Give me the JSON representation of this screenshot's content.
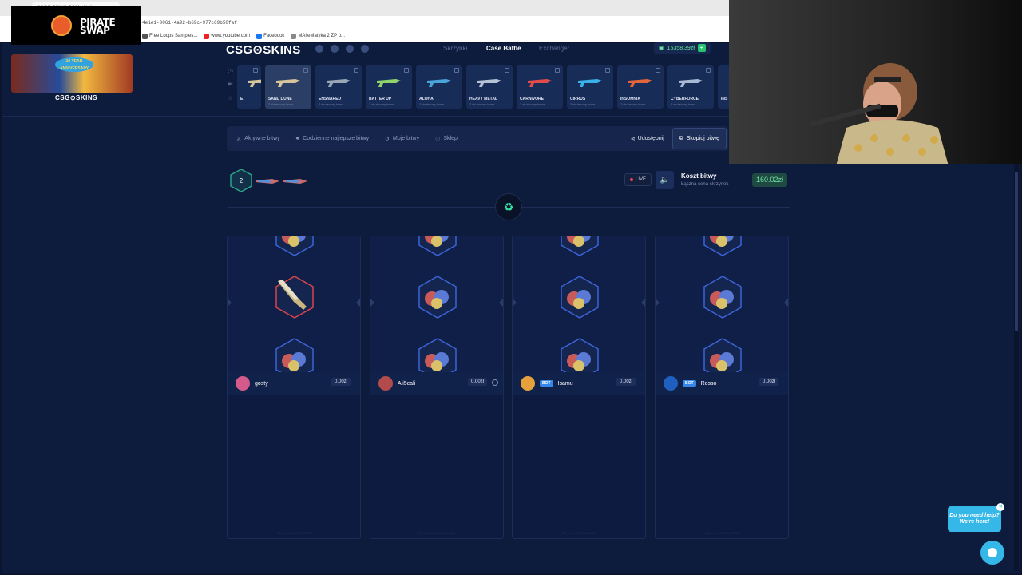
{
  "browser": {
    "tab_title": "CSGO-SKINS.COM - Najlep...",
    "url": "4e1e1-0061-4a92-b69c-977c69b50faf",
    "bookmarks": [
      "Free Loops Samples...",
      "www.youtube.com",
      "Facebook",
      "MAlleMatyka 2 ZP p..."
    ]
  },
  "overlay": {
    "brand_line1": "PIRATE",
    "brand_line2": "SWAP"
  },
  "site": {
    "banner_text": "10 YEAR ANNIVERSARY",
    "left_brand": "CSG⊙SKINS",
    "brand": "CSG⊙SKINS",
    "nav": [
      "Skrzynki",
      "Case Battle",
      "Exchanger"
    ],
    "nav_active": "Case Battle",
    "balance": "15358.39zł",
    "balance_plus": "+"
  },
  "cases": [
    {
      "name": "E",
      "sub": "...",
      "color": "#d6c49a"
    },
    {
      "name": "SAND DUNE",
      "sub": "3 skuteczny tema",
      "color": "#d6c49a"
    },
    {
      "name": "ENSNARED",
      "sub": "2 skuteczny tema",
      "color": "#9aa6b8"
    },
    {
      "name": "BATTER UP",
      "sub": "2 skuteczny tema",
      "color": "#8fd36b"
    },
    {
      "name": "ALOHA",
      "sub": "2 skuteczny tema",
      "color": "#4aa3d9"
    },
    {
      "name": "HEAVY METAL",
      "sub": "2 skuteczny tema",
      "color": "#b6c2d6"
    },
    {
      "name": "CARNIVORE",
      "sub": "2 skuteczny tema",
      "color": "#e14b4b"
    },
    {
      "name": "CIRRUS",
      "sub": "2 skuteczny tema",
      "color": "#3ab0e8"
    },
    {
      "name": "INSOMNIA",
      "sub": "2 skuteczny tema",
      "color": "#e2663a"
    },
    {
      "name": "CYBERFORCE",
      "sub": "2 skuteczny tema",
      "color": "#a9b8d4"
    },
    {
      "name": "INS",
      "sub": "...",
      "color": "#c6d0e0"
    }
  ],
  "battle_nav": {
    "items": [
      "Aktywne bitwy",
      "Codzienne najlepsze bitwy",
      "Moje bitwy",
      "Sklep"
    ],
    "share": "Udostępnij",
    "copy": "Skopiuj bitwę"
  },
  "battle": {
    "round": "2",
    "live": "LIVE",
    "cost_title": "Koszt bitwy",
    "cost_sub": "Łączna cena skrzynek",
    "cost_value": "160.02zł"
  },
  "players": [
    {
      "name": "gosty",
      "value": "0.00zł",
      "bot": false,
      "avatar_color": "#d35a8a",
      "winner_knife": true,
      "emote": false
    },
    {
      "name": "Ali5cali",
      "value": "0.00zł",
      "bot": false,
      "avatar_color": "#b24c4c",
      "winner_knife": false,
      "emote": true
    },
    {
      "name": "Isamu",
      "value": "0.00zł",
      "bot": true,
      "avatar_color": "#e6a13c",
      "winner_knife": false,
      "emote": false
    },
    {
      "name": "Rosso",
      "value": "0.00zł",
      "bot": true,
      "avatar_color": "#1f5fbf",
      "winner_knife": false,
      "emote": false
    }
  ],
  "bot_label": "BOT",
  "seeds": [
    "Client seed: 174c08005",
    "Client seed: ascmvbhh62aa",
    "Client seed: 174c08005",
    "Client seed: 174c08005"
  ],
  "help": {
    "text_line1": "Do you need help?",
    "text_line2": "We're here!",
    "close": "×"
  },
  "colors": {
    "accent": "#38e2a5",
    "background": "#0d1b3d",
    "help": "#35b7e8"
  }
}
